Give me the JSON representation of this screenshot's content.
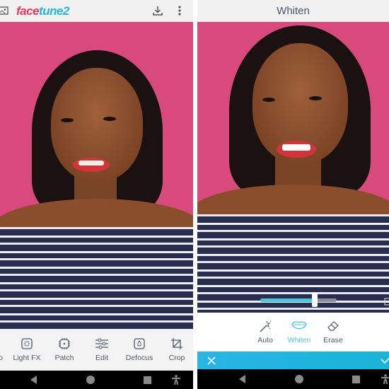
{
  "left": {
    "logo": {
      "part1": "face",
      "part2": "tune2"
    },
    "tools": [
      {
        "label": "o",
        "icon": "partial-icon"
      },
      {
        "label": "Light FX",
        "icon": "light-fx-icon"
      },
      {
        "label": "Patch",
        "icon": "patch-icon"
      },
      {
        "label": "Edit",
        "icon": "sliders-icon"
      },
      {
        "label": "Defocus",
        "icon": "defocus-icon"
      },
      {
        "label": "Crop",
        "icon": "crop-icon"
      }
    ]
  },
  "right": {
    "title": "Whiten",
    "slider": {
      "value": 0.71
    },
    "tools": [
      {
        "label": "Auto",
        "icon": "magic-wand-icon"
      },
      {
        "label": "Whiten",
        "icon": "lips-icon",
        "active": true
      },
      {
        "label": "Erase",
        "icon": "eraser-icon"
      }
    ]
  },
  "colors": {
    "accent": "#1fb6e6",
    "brand_red": "#f0365a",
    "active": "#4cc4dc"
  }
}
